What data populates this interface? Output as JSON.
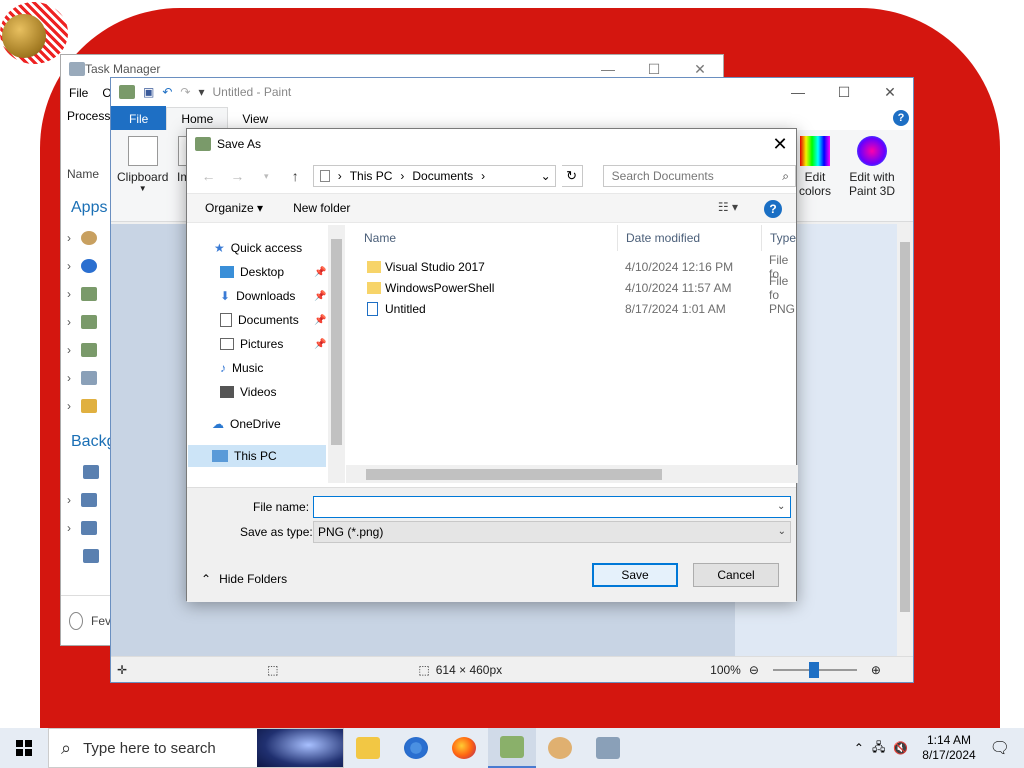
{
  "taskmgr": {
    "title": "Task Manager",
    "menu": [
      "File",
      "O"
    ],
    "tab": "Process",
    "column_name": "Name",
    "section_apps": "Apps",
    "section_background": "Backg",
    "footer": "Fev"
  },
  "paint": {
    "title": "Untitled - Paint",
    "tabs": {
      "file": "File",
      "home": "Home",
      "view": "View"
    },
    "ribbon": {
      "clipboard": "Clipboard",
      "image_partial": "Im",
      "edit_colors_1": "Edit",
      "edit_colors_2": "colors",
      "paint3d_1": "Edit with",
      "paint3d_2": "Paint 3D"
    },
    "status": {
      "dimensions": "614 × 460px",
      "zoom": "100%"
    }
  },
  "dialog": {
    "title": "Save As",
    "breadcrumb": [
      "This PC",
      "Documents"
    ],
    "search_placeholder": "Search Documents",
    "organize": "Organize",
    "new_folder": "New folder",
    "nav": {
      "quick_access": "Quick access",
      "desktop": "Desktop",
      "downloads": "Downloads",
      "documents": "Documents",
      "pictures": "Pictures",
      "music": "Music",
      "videos": "Videos",
      "onedrive": "OneDrive",
      "this_pc": "This PC"
    },
    "columns": {
      "name": "Name",
      "date": "Date modified",
      "type": "Type"
    },
    "files": [
      {
        "name": "Visual Studio 2017",
        "date": "4/10/2024 12:16 PM",
        "type": "File fo",
        "kind": "folder"
      },
      {
        "name": "WindowsPowerShell",
        "date": "4/10/2024 11:57 AM",
        "type": "File fo",
        "kind": "folder"
      },
      {
        "name": "Untitled",
        "date": "8/17/2024 1:01 AM",
        "type": "PNG",
        "kind": "png"
      }
    ],
    "file_name_label": "File name:",
    "file_name_value": "",
    "save_type_label": "Save as type:",
    "save_type_value": "PNG (*.png)",
    "hide_folders": "Hide Folders",
    "save": "Save",
    "cancel": "Cancel"
  },
  "taskbar": {
    "search_placeholder": "Type here to search",
    "time": "1:14 AM",
    "date": "8/17/2024"
  },
  "colors": {
    "accent": "#0078d7",
    "wallpaper_red": "#d4160f",
    "paint_file_tab": "#1e6fc4"
  }
}
